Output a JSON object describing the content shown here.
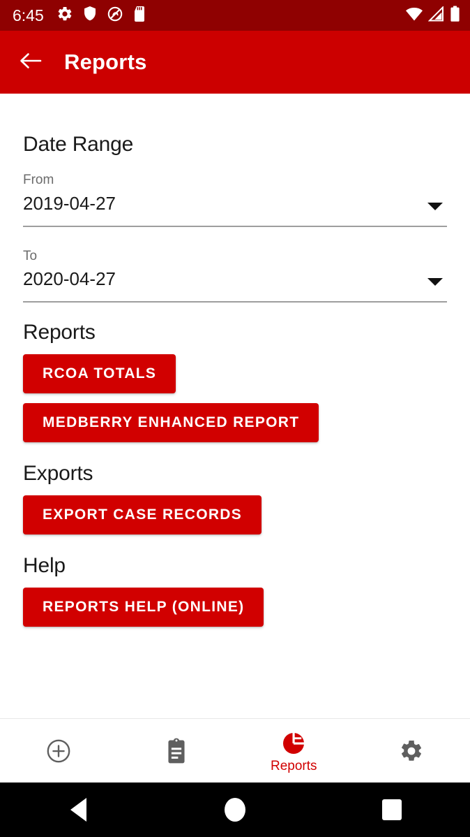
{
  "status_bar": {
    "time": "6:45",
    "left_icons": [
      "gear-icon",
      "shield-icon",
      "silent-mode-icon",
      "sd-card-icon"
    ],
    "right_icons": [
      "wifi-icon",
      "cellular-signal-icon",
      "battery-icon"
    ],
    "background_color": "#8f0101"
  },
  "app_bar": {
    "back_icon": "back-arrow-icon",
    "title": "Reports",
    "background_color": "#cc0000"
  },
  "main": {
    "date_range": {
      "heading": "Date Range",
      "fields": [
        {
          "label": "From",
          "value": "2019-04-27",
          "caret": "chevron-down-icon"
        },
        {
          "label": "To",
          "value": "2020-04-27",
          "caret": "chevron-down-icon"
        }
      ]
    },
    "reports": {
      "heading": "Reports",
      "buttons": [
        {
          "label": "RCOA TOTALS"
        },
        {
          "label": "MEDBERRY ENHANCED REPORT"
        }
      ]
    },
    "exports": {
      "heading": "Exports",
      "buttons": [
        {
          "label": "EXPORT CASE RECORDS"
        }
      ]
    },
    "help": {
      "heading": "Help",
      "buttons": [
        {
          "label": "REPORTS HELP (ONLINE)"
        }
      ]
    },
    "button_color": "#d10000"
  },
  "bottom_nav": {
    "items": [
      {
        "icon": "add-circle-icon",
        "label": "",
        "active": false
      },
      {
        "icon": "clipboard-icon",
        "label": "",
        "active": false
      },
      {
        "icon": "pie-chart-icon",
        "label": "Reports",
        "active": true
      },
      {
        "icon": "gear-icon",
        "label": "",
        "active": false
      }
    ],
    "active_color": "#d10000",
    "inactive_color": "#5f5f5f"
  },
  "android_nav": {
    "back": "back-triangle-icon",
    "home": "home-circle-icon",
    "recents": "recents-square-icon"
  }
}
